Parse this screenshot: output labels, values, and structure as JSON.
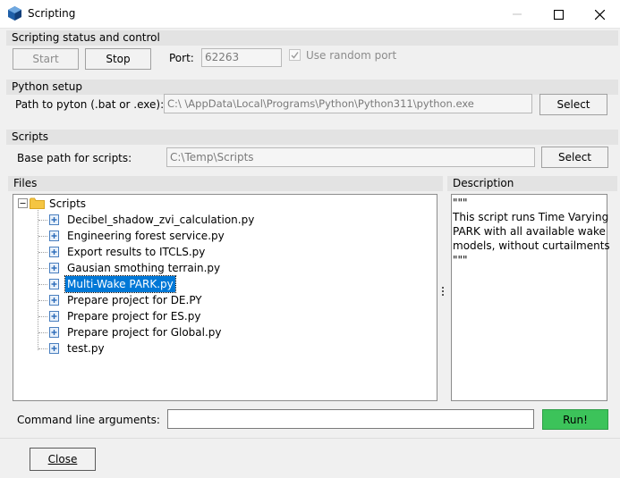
{
  "window": {
    "title": "Scripting",
    "minimize_icon": "minimize-icon",
    "maximize_icon": "maximize-icon",
    "close_icon": "close-icon"
  },
  "status_section": {
    "header": "Scripting status and control",
    "start_label": "Start",
    "stop_label": "Stop",
    "port_label": "Port:",
    "port_value": "62263",
    "random_port_label": "Use random port",
    "random_port_checked": true
  },
  "python_section": {
    "header": "Python setup",
    "path_label": "Path to pyton (.bat or .exe):",
    "path_value": "C:\\                        \\AppData\\Local\\Programs\\Python\\Python311\\python.exe",
    "select_label": "Select"
  },
  "scripts_section": {
    "header": "Scripts",
    "base_path_label": "Base path for scripts:",
    "base_path_value": "C:\\Temp\\Scripts",
    "select_label": "Select"
  },
  "files": {
    "header": "Files",
    "root": "Scripts",
    "items": [
      "Decibel_shadow_zvi_calculation.py",
      "Engineering forest service.py",
      "Export results to ITCLS.py",
      "Gausian smothing terrain.py",
      "Multi-Wake PARK.py",
      "Prepare project for DE.PY",
      "Prepare project for ES.py",
      "Prepare project for Global.py",
      "test.py"
    ],
    "selected_index": 4
  },
  "description": {
    "header": "Description",
    "lines": [
      "\"\"\"",
      "This script runs Time Varying",
      "PARK with all available wake",
      "models, without curtailments",
      "\"\"\""
    ]
  },
  "command": {
    "label": "Command line arguments:",
    "value": "",
    "run_label": "Run!"
  },
  "footer": {
    "close_label": "Close"
  },
  "colors": {
    "run_button": "#3cc35a",
    "selection": "#0078d7",
    "folder": "#f5c542"
  }
}
